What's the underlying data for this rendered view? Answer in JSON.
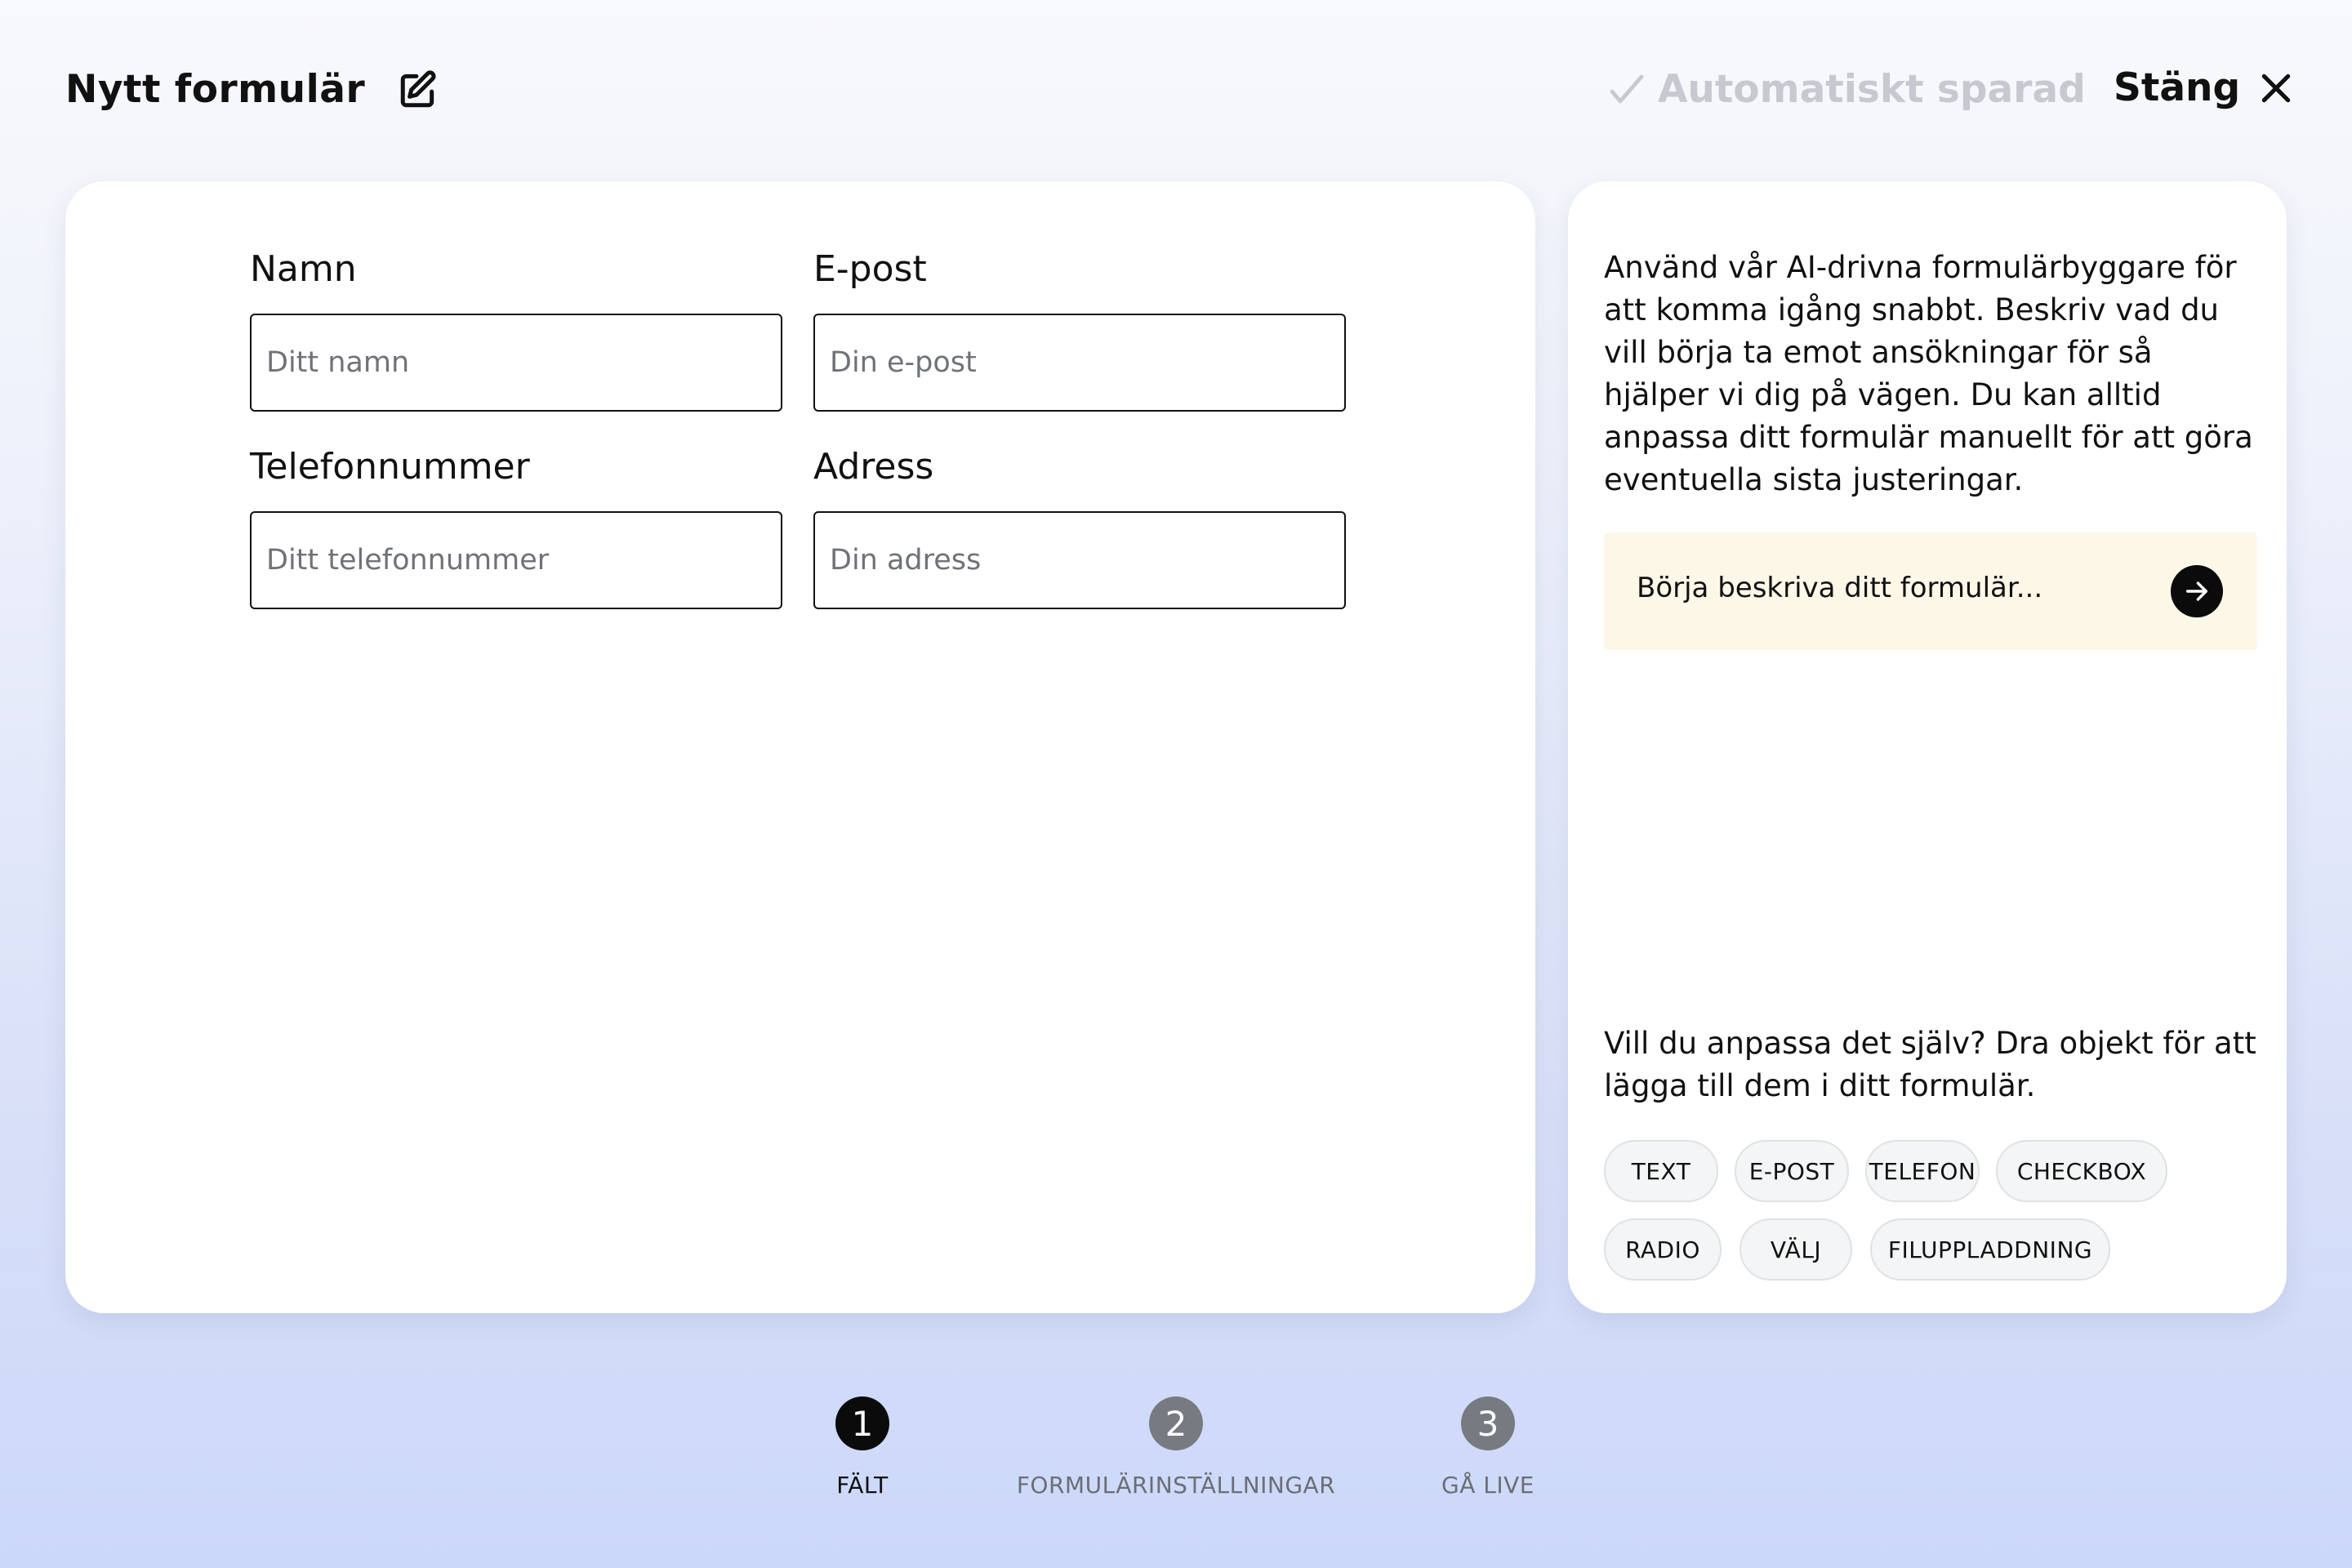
{
  "header": {
    "title": "Nytt formulär",
    "autosave_status": "Automatiskt sparad",
    "close_label": "Stäng"
  },
  "form": {
    "fields": [
      {
        "label": "Namn",
        "placeholder": "Ditt namn",
        "value": ""
      },
      {
        "label": "E-post",
        "placeholder": "Din e-post",
        "value": ""
      },
      {
        "label": "Telefonnummer",
        "placeholder": "Ditt telefonnummer",
        "value": ""
      },
      {
        "label": "Adress",
        "placeholder": "Din adress",
        "value": ""
      }
    ]
  },
  "assistant": {
    "intro": "Använd vår AI-drivna formulärbyggare för att komma igång snabbt. Beskriv vad du vill börja ta emot ansökningar för så hjälper vi dig på vägen. Du kan alltid anpassa ditt formulär manuellt för att göra eventuella sista justeringar.",
    "prompt_placeholder": "Börja beskriva ditt formulär...",
    "drag_hint": "Vill du anpassa det själv? Dra objekt för att lägga till dem i ditt formulär.",
    "field_types": [
      "TEXT",
      "E-POST",
      "TELEFON",
      "CHECKBOX",
      "RADIO",
      "VÄLJ",
      "FILUPPLADDNING"
    ]
  },
  "steps": [
    {
      "number": "1",
      "label": "FÄLT",
      "active": true
    },
    {
      "number": "2",
      "label": "FORMULÄRINSTÄLLNINGAR",
      "active": false
    },
    {
      "number": "3",
      "label": "GÅ LIVE",
      "active": false
    }
  ],
  "colors": {
    "text": "#111111",
    "muted": "#c6c9d0",
    "prompt_bg": "#fdf7e8",
    "active_step": "#0b0b0b",
    "inactive_step": "#777a80"
  },
  "icons": {
    "title": "edit-icon",
    "autosave": "check-icon",
    "close": "close-icon",
    "send": "arrow-right-icon"
  }
}
